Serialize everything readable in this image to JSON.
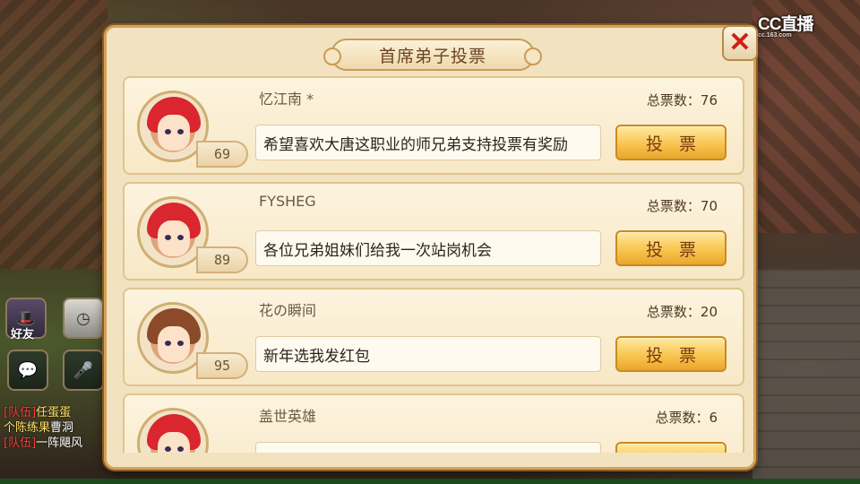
{
  "watermark": {
    "logo": "CC直播",
    "sub": "cc.163.com"
  },
  "hud": {
    "friend_label": "好友",
    "chat_lines": [
      {
        "prefix": "[队伍]",
        "name": "任蛋蛋",
        "text": ""
      },
      {
        "prefix": "",
        "name": "个陈练果",
        "text": "曹洞"
      },
      {
        "prefix": "[队伍]",
        "name": "",
        "text": "一阵飓风"
      }
    ]
  },
  "dialog": {
    "title": "首席弟子投票",
    "close_label": "✕",
    "candidates": [
      {
        "name": "忆江南 *",
        "level": "69",
        "motto": "希望喜欢大唐这职业的师兄弟支持投票有奖励",
        "votes_label": "总票数：76",
        "vote_button": "投票",
        "avatar_style": "red"
      },
      {
        "name": "FYSHEG",
        "level": "89",
        "motto": "各位兄弟姐妹们给我一次站岗机会",
        "votes_label": "总票数：70",
        "vote_button": "投票",
        "avatar_style": "red"
      },
      {
        "name": "花の瞬间",
        "level": "95",
        "motto": "新年选我发红包",
        "votes_label": "总票数：20",
        "vote_button": "投票",
        "avatar_style": "brown"
      },
      {
        "name": "盖世英雄",
        "level": "",
        "motto": "",
        "votes_label": "总票数：6",
        "vote_button": "",
        "avatar_style": "red"
      }
    ]
  }
}
